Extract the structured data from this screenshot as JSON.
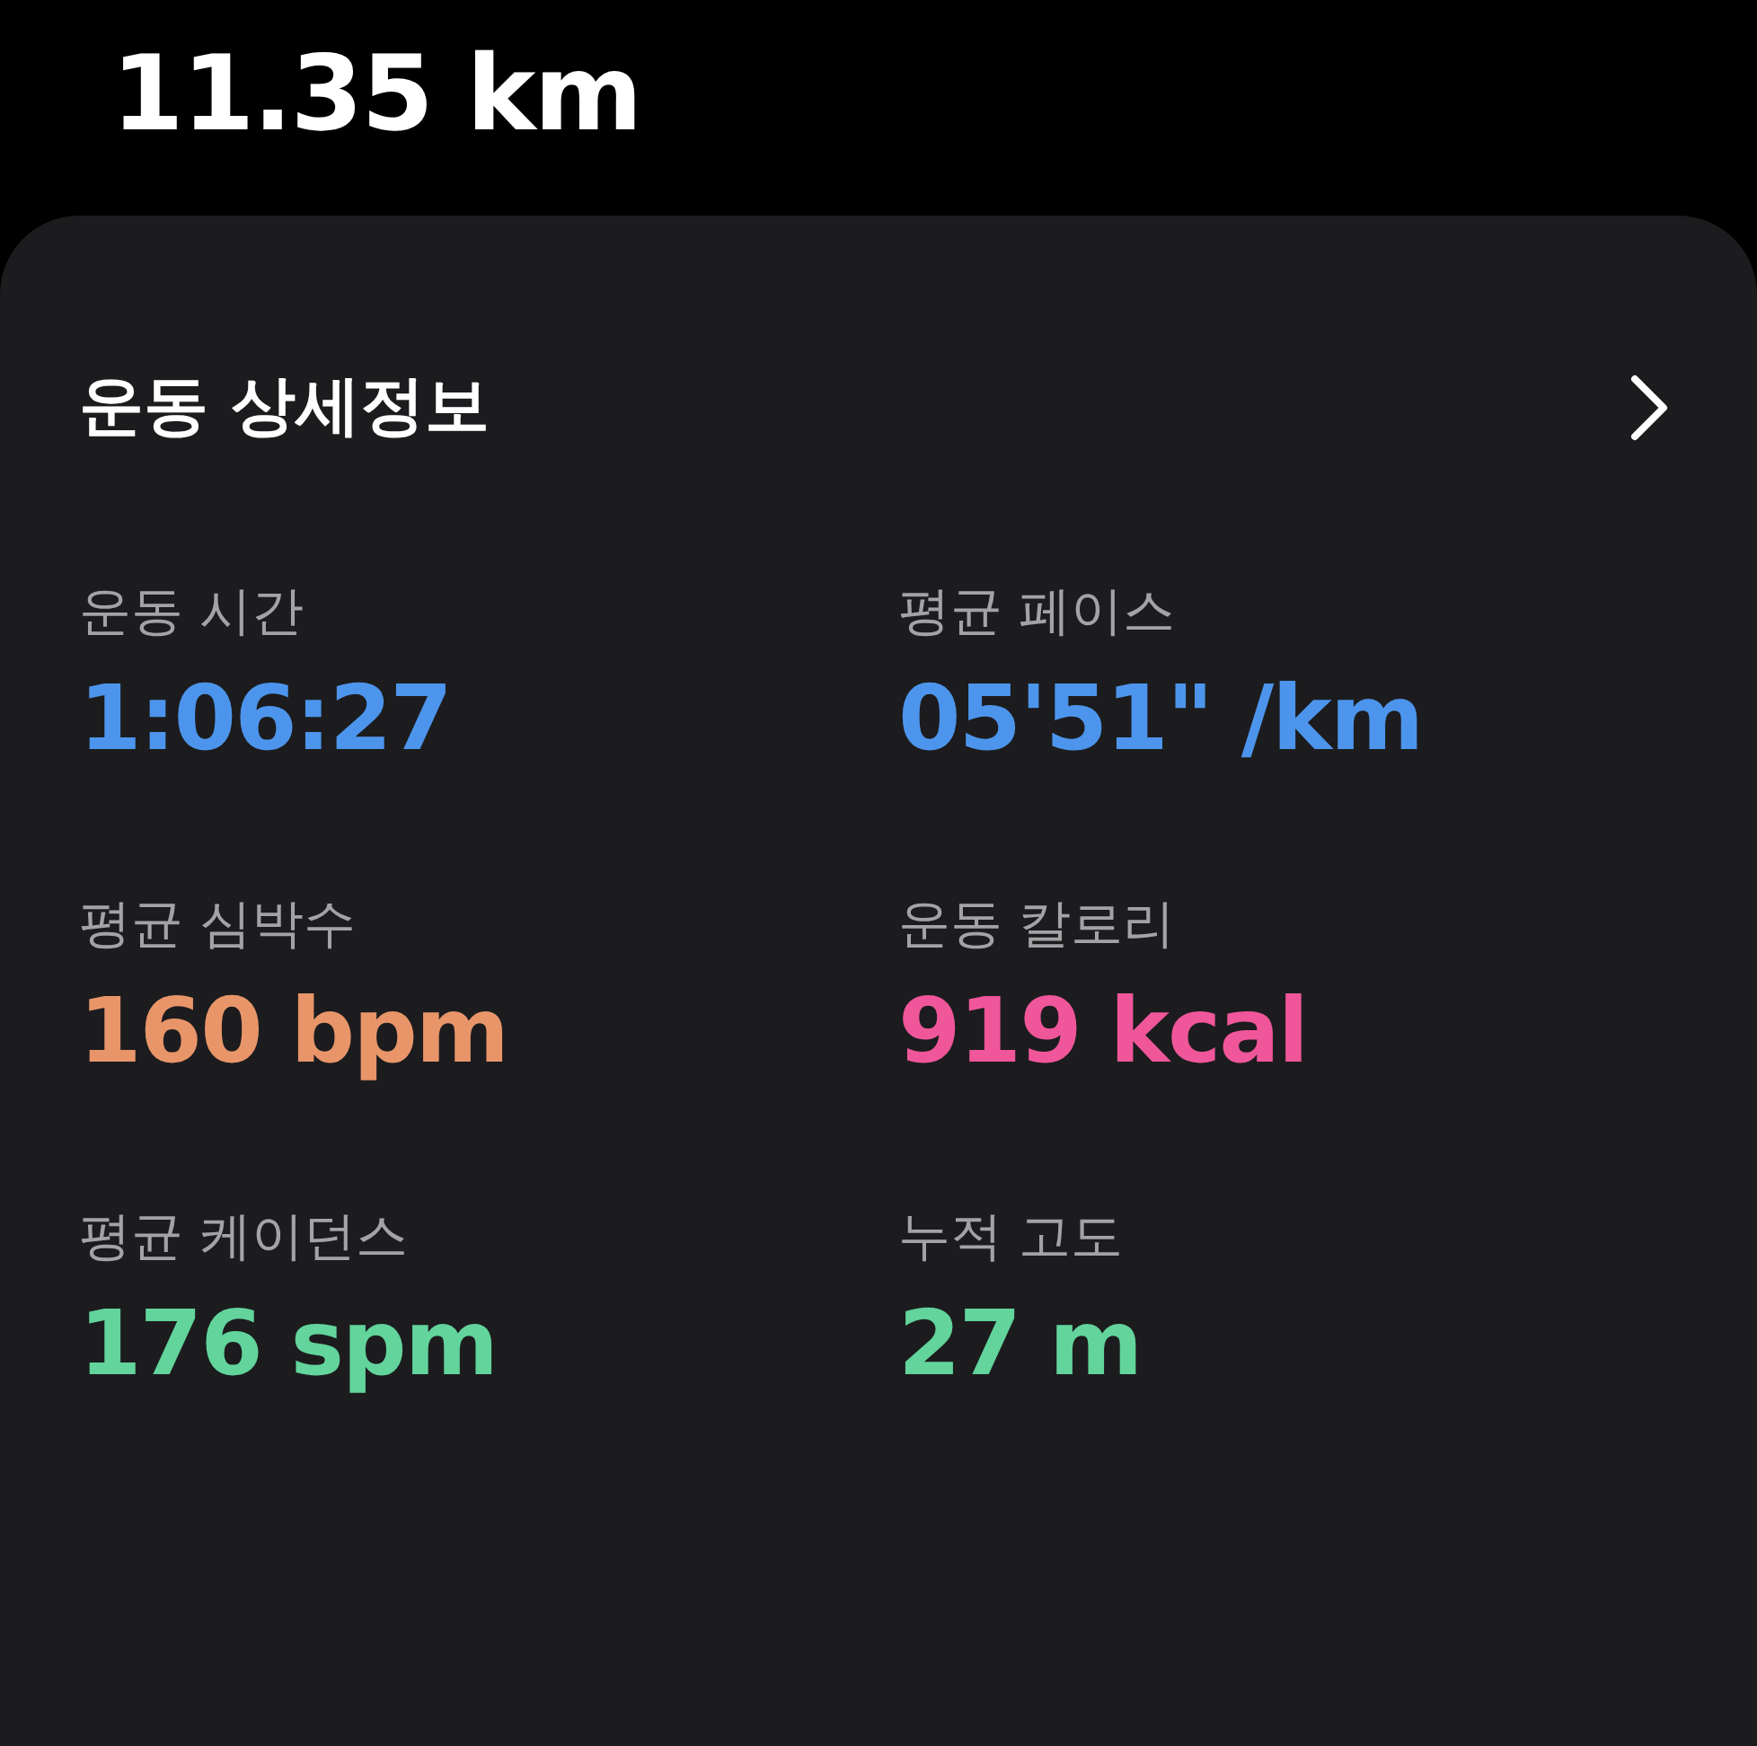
{
  "distance": "11.35 km",
  "card": {
    "title": "운동 상세정보",
    "metrics": [
      {
        "label": "운동 시간",
        "value": "1:06:27",
        "color": "#4d95ec"
      },
      {
        "label": "평균 페이스",
        "value": "05'51\" /km",
        "color": "#4d95ec"
      },
      {
        "label": "평균 심박수",
        "value": "160 bpm",
        "color": "#e8956a"
      },
      {
        "label": "운동 칼로리",
        "value": "919 kcal",
        "color": "#f0569a"
      },
      {
        "label": "평균 케이던스",
        "value": "176 spm",
        "color": "#62d49c"
      },
      {
        "label": "누적 고도",
        "value": "27 m",
        "color": "#62d49c"
      }
    ]
  }
}
